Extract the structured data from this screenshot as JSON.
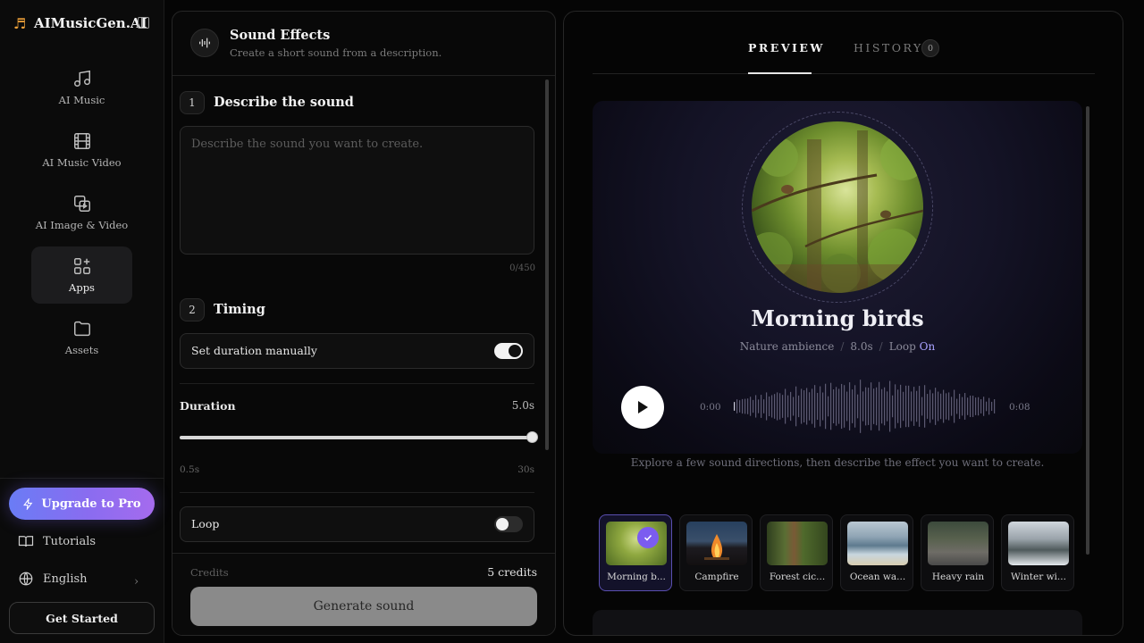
{
  "brand": {
    "name": "AIMusicGen.AI"
  },
  "sidebar": {
    "items": [
      {
        "label": "AI Music",
        "icon": "music-note-icon"
      },
      {
        "label": "AI Music Video",
        "icon": "film-icon"
      },
      {
        "label": "AI Image & Video",
        "icon": "image-video-icon"
      },
      {
        "label": "Apps",
        "icon": "apps-grid-icon",
        "active": true
      },
      {
        "label": "Assets",
        "icon": "folder-icon"
      }
    ],
    "upgrade_label": "Upgrade to Pro",
    "tutorials_label": "Tutorials",
    "language_label": "English",
    "get_started_label": "Get Started"
  },
  "sound_effects": {
    "title": "Sound Effects",
    "subtitle": "Create a short sound from a description.",
    "step1": {
      "number": "1",
      "title": "Describe the sound"
    },
    "description": {
      "value": "",
      "placeholder": "Describe the sound you want to create.",
      "char_count": "0/450"
    },
    "step2": {
      "number": "2",
      "title": "Timing"
    },
    "manual_duration": {
      "label": "Set duration manually",
      "enabled": true
    },
    "duration": {
      "label": "Duration",
      "value": "5.0s",
      "value_seconds": 5.0,
      "min": "0.5s",
      "max": "30s",
      "min_seconds": 0.5,
      "max_seconds": 30
    },
    "loop": {
      "label": "Loop",
      "enabled": false
    },
    "credits_label": "Credits",
    "credits_value": "5 credits",
    "generate_label": "Generate sound"
  },
  "preview": {
    "tabs": {
      "preview": "PREVIEW",
      "history": "HISTORY",
      "history_count": "0"
    },
    "title": "Morning birds",
    "category": "Nature ambience",
    "length": "8.0s",
    "loop_label": "Loop",
    "loop_value": "On",
    "time_start": "0:00",
    "time_end": "0:08",
    "hint": "Explore a few sound directions, then describe the effect you want to create.",
    "presets": [
      {
        "label": "Morning b...",
        "selected": true
      },
      {
        "label": "Campfire"
      },
      {
        "label": "Forest cic..."
      },
      {
        "label": "Ocean wa..."
      },
      {
        "label": "Heavy rain"
      },
      {
        "label": "Winter wi..."
      }
    ]
  },
  "colors": {
    "accent": "#7b5cf0",
    "accent_light": "#a9a2ff",
    "upgrade_gradient_start": "#6a7cf5",
    "upgrade_gradient_end": "#a56bee"
  }
}
